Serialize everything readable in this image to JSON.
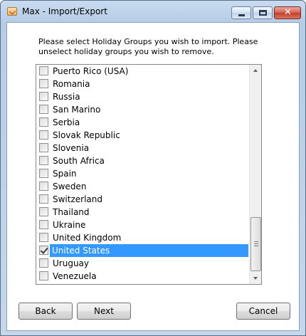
{
  "window": {
    "title": "Max - Import/Export",
    "close_glyph": "✕"
  },
  "dialog": {
    "prompt": "Please select Holiday Groups you wish to import. Please unselect holiday groups you wish to remove."
  },
  "holiday_groups": [
    {
      "label": "Puerto Rico (USA)",
      "checked": false,
      "selected": false
    },
    {
      "label": "Romania",
      "checked": false,
      "selected": false
    },
    {
      "label": "Russia",
      "checked": false,
      "selected": false
    },
    {
      "label": "San Marino",
      "checked": false,
      "selected": false
    },
    {
      "label": "Serbia",
      "checked": false,
      "selected": false
    },
    {
      "label": "Slovak Republic",
      "checked": false,
      "selected": false
    },
    {
      "label": "Slovenia",
      "checked": false,
      "selected": false
    },
    {
      "label": "South Africa",
      "checked": false,
      "selected": false
    },
    {
      "label": "Spain",
      "checked": false,
      "selected": false
    },
    {
      "label": "Sweden",
      "checked": false,
      "selected": false
    },
    {
      "label": "Switzerland",
      "checked": false,
      "selected": false
    },
    {
      "label": "Thailand",
      "checked": false,
      "selected": false
    },
    {
      "label": "Ukraine",
      "checked": false,
      "selected": false
    },
    {
      "label": "United Kingdom",
      "checked": false,
      "selected": false
    },
    {
      "label": "United States",
      "checked": true,
      "selected": true
    },
    {
      "label": "Uruguay",
      "checked": false,
      "selected": false
    },
    {
      "label": "Venezuela",
      "checked": false,
      "selected": false
    }
  ],
  "buttons": {
    "back": "Back",
    "next": "Next",
    "cancel": "Cancel"
  },
  "colors": {
    "selection": "#3399ff"
  },
  "icons": {
    "app": "envelope-icon",
    "minimize": "minimize-icon",
    "maximize": "maximize-icon",
    "close": "close-icon"
  }
}
